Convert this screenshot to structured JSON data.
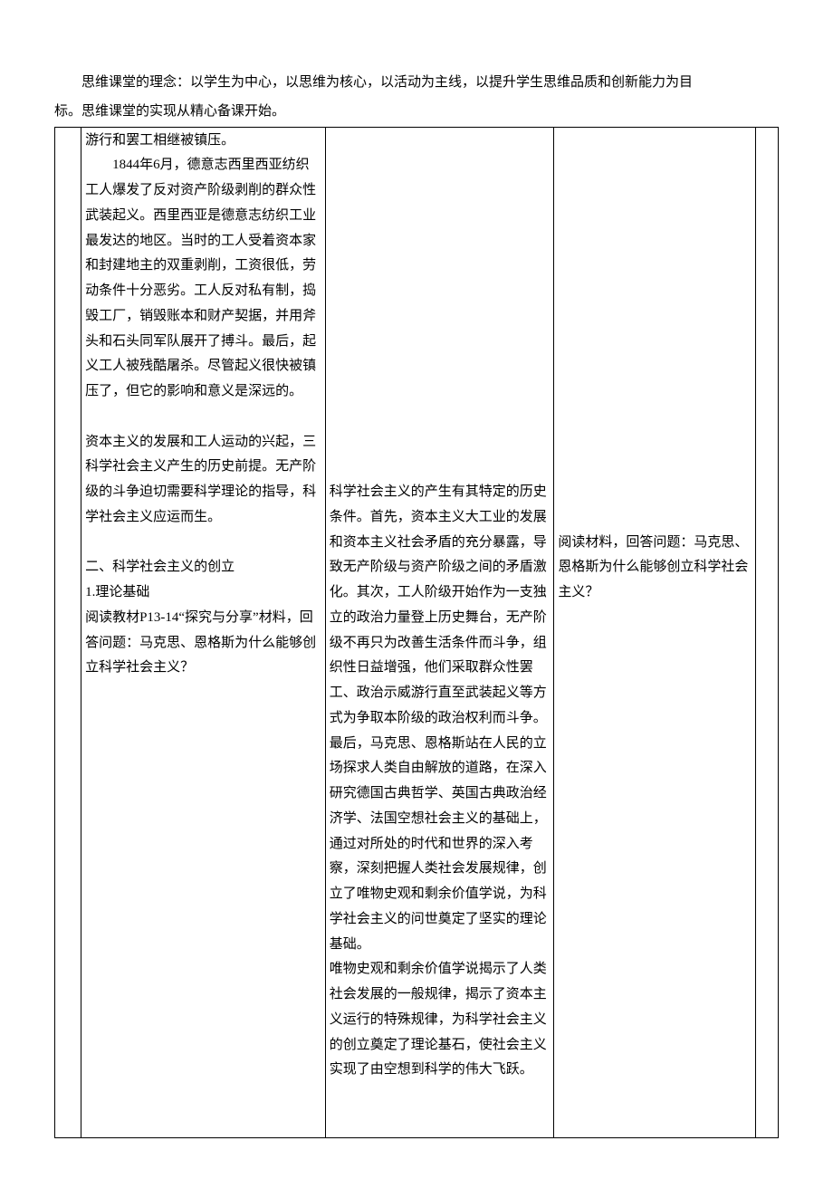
{
  "header": {
    "line1": "思维课堂的理念：以学生为中心，以思维为核心，以活动为主线，以提升学生思维品质和创新能力为目",
    "line2": "标。思维课堂的实现从精心备课开始。"
  },
  "colB": {
    "p1": "游行和罢工相继被镇压。",
    "p2": "1844年6月，德意志西里西亚纺织工人爆发了反对资产阶级剥削的群众性武装起义。西里西亚是德意志纺织工业最发达的地区。当时的工人受着资本家和封建地主的双重剥削，工资很低，劳动条件十分恶劣。工人反对私有制，捣毁工厂，销毁账本和财产契据，并用斧头和石头同军队展开了搏斗。最后，起义工人被残酷屠杀。尽管起义很快被镇压了，但它的影响和意义是深远的。",
    "p3": "资本主义的发展和工人运动的兴起，三科学社会主义产生的历史前提。无产阶级的斗争迫切需要科学理论的指导，科学社会主义应运而生。",
    "p4": "二、科学社会主义的创立",
    "p5": "1.理论基础",
    "p6": "阅读教材P13-14“探究与分享”材料，回答问题：马克思、恩格斯为什么能够创立科学社会主义？"
  },
  "colC": {
    "p1": "科学社会主义的产生有其特定的历史条件。首先，资本主义大工业的发展和资本主义社会矛盾的充分暴露，导致无产阶级与资产阶级之间的矛盾激化。其次，工人阶级开始作为一支独立的政治力量登上历史舞台，无产阶级不再只为改善生活条件而斗争，组织性日益增强，他们采取群众性罢工、政治示威游行直至武装起义等方式为争取本阶级的政治权利而斗争。最后，马克思、恩格斯站在人民的立场探求人类自由解放的道路，在深入研究德国古典哲学、英国古典政治经济学、法国空想社会主义的基础上，通过对所处的时代和世界的深入考察，深刻把握人类社会发展规律，创立了唯物史观和剩余价值学说，为科学社会主义的问世奠定了坚实的理论基础。",
    "p2": "唯物史观和剩余价值学说揭示了人类社会发展的一般规律，揭示了资本主义运行的特殊规律，为科学社会主义的创立奠定了理论基石，使社会主义实现了由空想到科学的伟大飞跃。"
  },
  "colD": {
    "p1": "阅读材料，回答问题：马克思、恩格斯为什么能够创立科学社会主义？"
  }
}
